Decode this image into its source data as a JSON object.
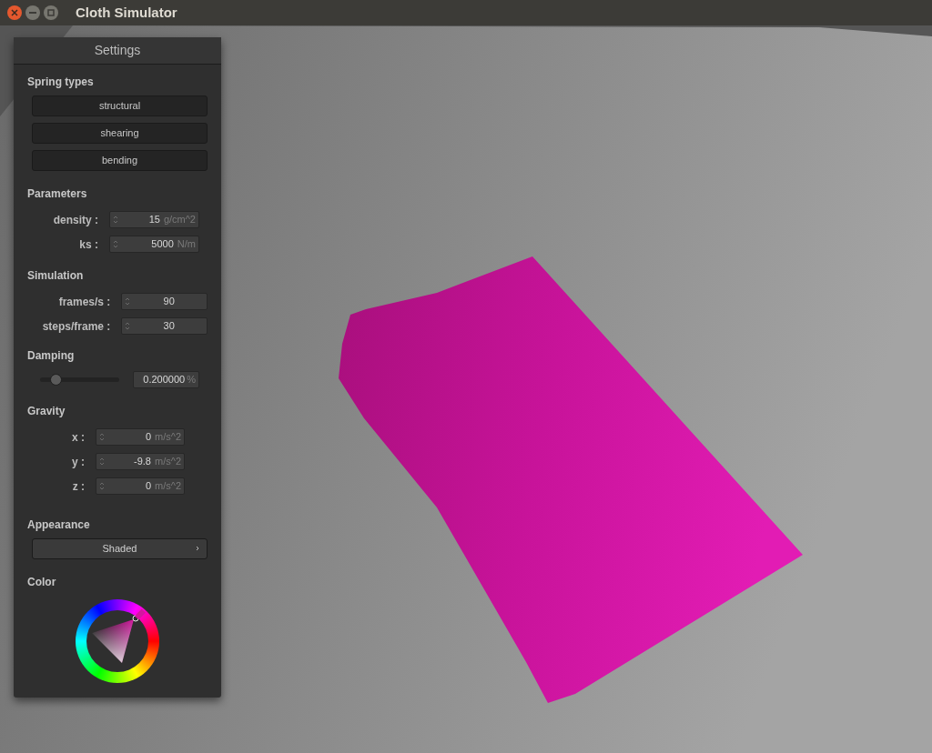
{
  "window": {
    "title": "Cloth Simulator"
  },
  "settings": {
    "title": "Settings",
    "spring_types": {
      "heading": "Spring types",
      "buttons": [
        "structural",
        "shearing",
        "bending"
      ]
    },
    "parameters": {
      "heading": "Parameters",
      "fields": [
        {
          "label": "density :",
          "value": "15",
          "unit": "g/cm^2"
        },
        {
          "label": "ks :",
          "value": "5000",
          "unit": "N/m"
        }
      ]
    },
    "simulation": {
      "heading": "Simulation",
      "fields": [
        {
          "label": "frames/s :",
          "value": "90"
        },
        {
          "label": "steps/frame :",
          "value": "30"
        }
      ]
    },
    "damping": {
      "heading": "Damping",
      "level": 0.2,
      "value": "0.200000",
      "unit": "%"
    },
    "gravity": {
      "heading": "Gravity",
      "fields": [
        {
          "label": "x :",
          "value": "0",
          "unit": "m/s^2"
        },
        {
          "label": "y :",
          "value": "-9.8",
          "unit": "m/s^2"
        },
        {
          "label": "z :",
          "value": "0",
          "unit": "m/s^2"
        }
      ]
    },
    "appearance": {
      "heading": "Appearance",
      "value": "Shaded"
    },
    "color": {
      "heading": "Color",
      "color": "#d4179f"
    }
  }
}
